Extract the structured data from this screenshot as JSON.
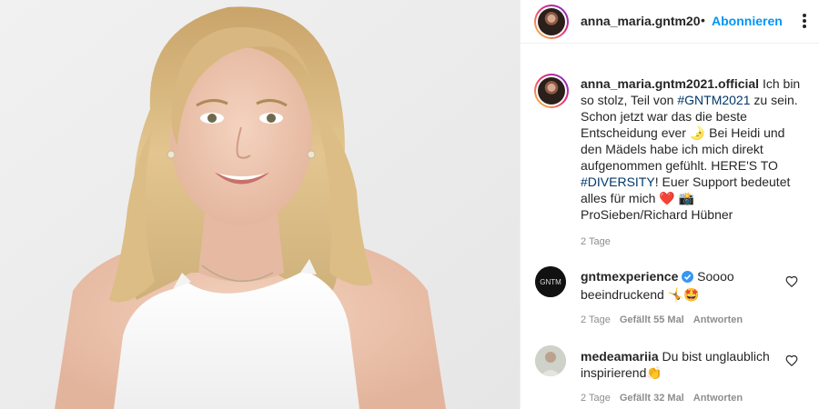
{
  "post": {
    "username": "anna_maria.gntm2021.official",
    "header_username": "anna_maria.gntm202",
    "separator": "•",
    "follow_label": "Abonnieren",
    "caption_parts": {
      "t1": "Ich bin so stolz, Teil von ",
      "tag1": "#GNTM2021",
      "t2": " zu sein. Schon jetzt war das die beste Entscheidung ever ",
      "emoji1": "🌛",
      "t3": " Bei Heidi und den Mädels habe ich mich direkt aufgenommen gefühlt. HERE'S TO ",
      "tag2": "#DIVERSITY",
      "t4": "! Euer Support bedeutet alles für mich ",
      "emoji2": "❤️",
      "emoji3": "📸",
      "t5": " ProSieben/Richard Hübner"
    },
    "caption_time": "2 Tage"
  },
  "comments": [
    {
      "username": "gntmexperience",
      "verified": true,
      "text": "Soooo beeindruckend",
      "emojis": "🤸🤩",
      "time": "2 Tage",
      "likes": "Gefällt 55 Mal",
      "reply": "Antworten",
      "avatar_text": "GNTM"
    },
    {
      "username": "medeamariia",
      "verified": false,
      "text": "Du bist unglaublich inspirierend",
      "emojis": "👏",
      "time": "2 Tage",
      "likes": "Gefällt 32 Mal",
      "reply": "Antworten"
    }
  ],
  "colors": {
    "link": "#0095f6",
    "hashtag": "#00376b",
    "meta": "#8e8e8e",
    "text": "#262626",
    "verified": "#3897f0"
  },
  "icons": [
    "more-options-icon",
    "verified-badge-icon",
    "heart-icon"
  ]
}
